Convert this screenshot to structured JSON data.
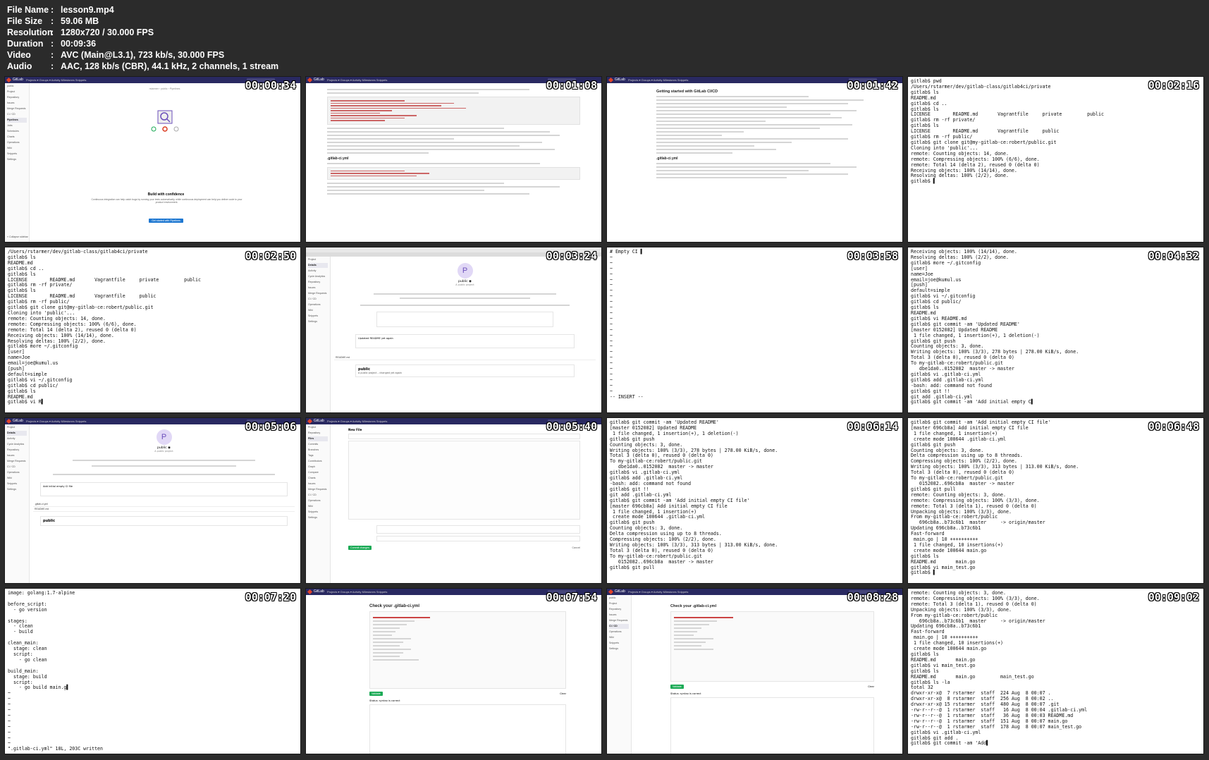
{
  "header": [
    {
      "key": "File Name",
      "value": "lesson9.mp4"
    },
    {
      "key": "File Size",
      "value": "59.06 MB"
    },
    {
      "key": "Resolution",
      "value": "1280x720 / 30.000 FPS"
    },
    {
      "key": "Duration",
      "value": "00:09:36"
    },
    {
      "key": "Video",
      "value": "AVC (Main@L3.1), 723 kb/s, 30.000 FPS"
    },
    {
      "key": "Audio",
      "value": "AAC, 128 kb/s (CBR), 44.1 kHz, 2 channels, 1 stream"
    }
  ],
  "colon": ":",
  "gitlab": {
    "brand": "GitLab",
    "nav": "Projects ▾   Groups ▾   Activity   Milestones   Snippets",
    "project_name": "public",
    "sidebar": [
      "Project",
      "Repository",
      "Issues",
      "Merge Requests",
      "CI / CD",
      "Pipelines",
      "Jobs",
      "Schedules",
      "Charts",
      "Operations",
      "Wiki",
      "Snippets",
      "Settings"
    ],
    "sidebar_repo": [
      "Project",
      "Details",
      "Activity",
      "Cycle Analytics",
      "Repository",
      "Issues",
      "Merge Requests",
      "CI / CD",
      "Operations",
      "Wiki",
      "Snippets",
      "Settings"
    ],
    "sidebar_files": [
      "Project",
      "Repository",
      "Files",
      "Commits",
      "Branches",
      "Tags",
      "Contributors",
      "Graph",
      "Compare",
      "Charts",
      "Issues",
      "Merge Requests",
      "CI / CD",
      "Operations",
      "Wiki",
      "Snippets",
      "Settings"
    ],
    "collapse": "« Collapse sidebar",
    "crumb_pipelines": "rstarmer › public › Pipelines",
    "build_title": "Build with confidence",
    "build_text": "Continuous integration can help catch bugs by running your tests automatically, while continuous deployment can help you deliver code to your product environment.",
    "build_button": "Get started with Pipelines",
    "ci_doc_title": "Getting started with GitLab CI/CD",
    "gitlab_ci_heading": ".gitlab-ci.yml",
    "project_avatar": "P",
    "project_title": "public ◉",
    "project_desc": "A public project",
    "file_name": "README.md",
    "commit_msg": "Updated README yet again",
    "commit_msg2": "Add initial empty CI file",
    "new_file_title": "New File",
    "commit_button": "Commit changes",
    "cancel": "Cancel",
    "check_title": "Check your .gitlab-ci.yml",
    "validate": "Validate",
    "clear": "Clear",
    "status_label": "Status: syntax is correct",
    "readme_heading": "public",
    "readme_text": "A public project – changed yet again"
  },
  "tiles": [
    {
      "time": "00:00:34"
    },
    {
      "time": "00:01:08"
    },
    {
      "time": "00:01:42"
    },
    {
      "time": "00:02:16",
      "text": "gitlab$ pwd\n/Users/rstarmer/dev/gitlab-class/gitlab4ci/private\ngitlab$ ls\nREADME.md\ngitlab$ cd ..\ngitlab$ ls\nLICENSE        README.md       Vagrantfile     private         public\ngitlab$ rm -rf private/\ngitlab$ ls\nLICENSE        README.md       Vagrantfile     public\ngitlab$ rm -rf public/\ngitlab$ git clone git@my-gitlab-ce:robert/public.git\nCloning into 'public'...\nremote: Counting objects: 14, done.\nremote: Compressing objects: 100% (6/6), done.\nremote: Total 14 (delta 2), reused 0 (delta 0)\nReceiving objects: 100% (14/14), done.\nResolving deltas: 100% (2/2), done.\ngitlab$ ▌"
    },
    {
      "time": "00:02:50",
      "text": "/Users/rstarmer/dev/gitlab-class/gitlab4ci/private\ngitlab$ ls\nREADME.md\ngitlab$ cd ..\ngitlab$ ls\nLICENSE        README.md       Vagrantfile     private         public\ngitlab$ rm -rf private/\ngitlab$ ls\nLICENSE        README.md       Vagrantfile     public\ngitlab$ rm -rf public/\ngitlab$ git clone git@my-gitlab-ce:robert/public.git\nCloning into 'public'...\nremote: Counting objects: 14, done.\nremote: Compressing objects: 100% (6/6), done.\nremote: Total 14 (delta 2), reused 0 (delta 0)\nReceiving objects: 100% (14/14), done.\nResolving deltas: 100% (2/2), done.\ngitlab$ more ~/.gitconfig\n[user]\nname=Joe\nemail=joe@kumul.us\n[push]\ndefault=simple\ngitlab$ vi ~/.gitconfig\ngitlab$ cd public/\ngitlab$ ls\nREADME.md\ngitlab$ vi R▌"
    },
    {
      "time": "00:03:24"
    },
    {
      "time": "00:03:58",
      "text": "# Empty CI ▌\n~\n~\n~\n~\n~\n~\n~\n~\n~\n~\n~\n~\n~\n~\n~\n~\n~\n~\n~\n~\n~\n~\n~\n~\n~\n-- INSERT --"
    },
    {
      "time": "00:04:32",
      "text": "Receiving objects: 100% (14/14), done.\nResolving deltas: 100% (2/2), done.\ngitlab$ more ~/.gitconfig\n[user]\nname=Joe\nemail=joe@kumul.us\n[push]\ndefault=simple\ngitlab$ vi ~/.gitconfig\ngitlab$ cd public/\ngitlab$ ls\nREADME.md\ngitlab$ vi README.md\ngitlab$ git commit -am 'Updated README'\n[master 0152082] Updated README\n 1 file changed, 1 insertion(+), 1 deletion(-)\ngitlab$ git push\nCounting objects: 3, done.\nWriting objects: 100% (3/3), 278 bytes | 278.00 KiB/s, done.\nTotal 3 (delta 0), reused 0 (delta 0)\nTo my-gitlab-ce:robert/public.git\n   dbe1da0..0152082  master -> master\ngitlab$ vi .gitlab-ci.yml\ngitlab$ add .gitlab-ci.yml\n-bash: add: command not found\ngitlab$ git !!\ngit add .gitlab-ci.yml\ngitlab$ git commit -am 'Add initial empty C▌"
    },
    {
      "time": "00:05:06"
    },
    {
      "time": "00:05:40"
    },
    {
      "time": "00:06:14",
      "text": "gitlab$ git commit -am 'Updated README'\n[master 0152082] Updated README\n 1 file changed, 1 insertion(+), 1 deletion(-)\ngitlab$ git push\nCounting objects: 3, done.\nWriting objects: 100% (3/3), 278 bytes | 278.00 KiB/s, done.\nTotal 3 (delta 0), reused 0 (delta 0)\nTo my-gitlab-ce:robert/public.git\n   dbe1da0..0152082  master -> master\ngitlab$ vi .gitlab-ci.yml\ngitlab$ add .gitlab-ci.yml\n-bash: add: command not found\ngitlab$ git !!\ngit add .gitlab-ci.yml\ngitlab$ git commit -am 'Add initial empty CI file'\n[master 696cb8a] Add initial empty CI file\n 1 file changed, 1 insertion(+)\n create mode 100644 .gitlab-ci.yml\ngitlab$ git push\nCounting objects: 3, done.\nDelta compression using up to 8 threads.\nCompressing objects: 100% (2/2), done.\nWriting objects: 100% (3/3), 313 bytes | 313.00 KiB/s, done.\nTotal 3 (delta 0), reused 0 (delta 0)\nTo my-gitlab-ce:robert/public.git\n   0152082..696cb8a  master -> master\ngitlab$ git pull"
    },
    {
      "time": "00:06:48",
      "text": "gitlab$ git commit -am 'Add initial empty CI file'\n[master 696cb8a] Add initial empty CI file\n 1 file changed, 1 insertion(+)\n create mode 100644 .gitlab-ci.yml\ngitlab$ git push\nCounting objects: 3, done.\nDelta compression using up to 8 threads.\nCompressing objects: 100% (2/2), done.\nWriting objects: 100% (3/3), 313 bytes | 313.00 KiB/s, done.\nTotal 3 (delta 0), reused 0 (delta 0)\nTo my-gitlab-ce:robert/public.git\n   0152082..696cb8a  master -> master\ngitlab$ git pull\nremote: Counting objects: 3, done.\nremote: Compressing objects: 100% (3/3), done.\nremote: Total 3 (delta 1), reused 0 (delta 0)\nUnpacking objects: 100% (3/3), done.\nFrom my-gitlab-ce:robert/public\n   696cb8a..b73c6b1  master     -> origin/master\nUpdating 696cb8a..b73c6b1\nFast-forward\n main.go | 10 ++++++++++\n 1 file changed, 10 insertions(+)\n create mode 100644 main.go\ngitlab$ ls\nREADME.md       main.go\ngitlab$ vi main_test.go\ngitlab$ ▌"
    },
    {
      "time": "00:07:20",
      "text": "image: golang:1.7-alpine\n\nbefore_script:\n  - go version\n\nstages:\n  - clean\n  - build\n\nclean_main:\n  stage: clean\n  script:\n    - go clean\n\nbuild_main:\n  stage: build\n  script:\n    - go build main.g▌\n~\n~\n~\n~\n~\n~\n~\n~\n~\n~\n\".gitlab-ci.yml\" 18L, 203C written"
    },
    {
      "time": "00:07:54"
    },
    {
      "time": "00:08:28"
    },
    {
      "time": "00:09:02",
      "text": "remote: Counting objects: 3, done.\nremote: Compressing objects: 100% (3/3), done.\nremote: Total 3 (delta 1), reused 0 (delta 0)\nUnpacking objects: 100% (3/3), done.\nFrom my-gitlab-ce:robert/public\n   696cb8a..b73c6b1  master     -> origin/master\nUpdating 696cb8a..b73c6b1\nFast-forward\n main.go | 10 ++++++++++\n 1 file changed, 10 insertions(+)\n create mode 100644 main.go\ngitlab$ ls\nREADME.md       main.go\ngitlab$ vi main_test.go\ngitlab$ ls\nREADME.md       main.go         main_test.go\ngitlab$ ls -la\ntotal 32\ndrwxr-xr-x@  7 rstarmer  staff  224 Aug  8 00:07 .\ndrwxr-xr-x@  8 rstarmer  staff  256 Aug  8 00:02 ..\ndrwxr-xr-x@ 15 rstarmer  staff  480 Aug  8 00:07 .git\n-rw-r--r--@  1 rstarmer  staff   16 Aug  8 00:04 .gitlab-ci.yml\n-rw-r--r--@  1 rstarmer  staff   36 Aug  8 00:03 README.md\n-rw-r--r--@  1 rstarmer  staff  151 Aug  8 00:07 main.go\n-rw-r--r--@  1 rstarmer  staff  178 Aug  8 00:07 main_test.go\ngitlab$ vi .gitlab-ci.yml\ngitlab$ git add .\ngitlab$ git commit -am 'Add▌"
    }
  ]
}
